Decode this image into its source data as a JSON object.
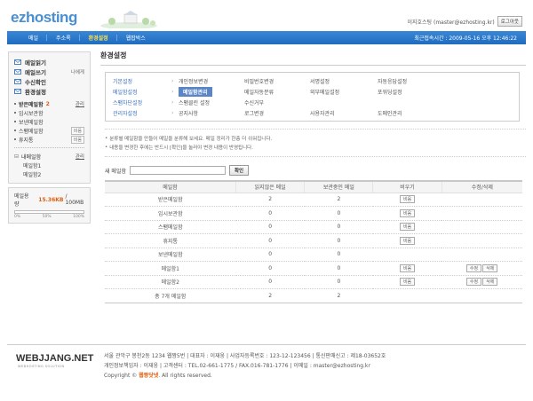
{
  "header": {
    "logo": "ezhosting",
    "user_text": "이지호스팅 (master@ezhosting.kr)",
    "logout_label": "로그아웃"
  },
  "topnav": {
    "items": [
      "메일",
      "주소록",
      "환경설정",
      "웹팝박스"
    ],
    "active_index": 2,
    "last_login": "최근접속시간 : 2009-05-16 오후 12:46:22"
  },
  "sidebar": {
    "main_items": [
      {
        "label": "메일읽기",
        "icon": "mail-read-icon"
      },
      {
        "label": "메일쓰기",
        "icon": "mail-write-icon",
        "extra": "나에게"
      },
      {
        "label": "수신확인",
        "icon": "receipt-check-icon"
      },
      {
        "label": "환경설정",
        "icon": "settings-icon"
      }
    ],
    "inbox_label": "받은메일함",
    "inbox_count": "2",
    "manage_label": "관리",
    "folders": [
      {
        "label": "임시보관함"
      },
      {
        "label": "보낸메일함"
      },
      {
        "label": "스팸메일함",
        "action": "비움"
      },
      {
        "label": "휴지통",
        "action": "비움"
      }
    ],
    "my_folders_label": "내메일함",
    "my_manage_label": "관리",
    "my_folders": [
      "메일함1",
      "메일함2"
    ],
    "quota": {
      "label": "메일용량",
      "used": "15.36KB",
      "total": "/ 100MB",
      "fraction": 0.0002,
      "scale": [
        "0%",
        "50%",
        "100%"
      ]
    }
  },
  "content": {
    "title": "환경설정",
    "settings_rows": [
      [
        "기본설정",
        "개인정보변경",
        "비밀번호변경",
        "서명설정",
        "자동응답설정"
      ],
      [
        "메일함설정",
        "메일함관리",
        "메일자동분류",
        "외부메일설정",
        "포워딩설정"
      ],
      [
        "스팸차단설정",
        "스팸클린 설정",
        "수신거부",
        "",
        ""
      ],
      [
        "관리자설정",
        "공지사항",
        "로그변경",
        "사용자관리",
        "도메인관리"
      ]
    ],
    "selected_setting": "메일함관리",
    "notes": [
      "분류별 메일함을 만들어 메일을 분류해 보세요. 메일 정리가 한층 더 쉬워집니다.",
      "내용을 변경한 후에는 반드시 [확인]을 눌러야 변경 내용이 반영됩니다."
    ],
    "new_folder_label": "새 메일함",
    "new_folder_value": "",
    "confirm_label": "확인",
    "table": {
      "headers": [
        "메일함",
        "읽지않은 메일",
        "보관중인 메일",
        "비우기",
        "수정/삭제"
      ],
      "rows": [
        {
          "name": "받은메일함",
          "unread": "2",
          "stored": "2",
          "empty": "비움",
          "edit": "",
          "delete": ""
        },
        {
          "name": "임시보관함",
          "unread": "0",
          "stored": "0",
          "empty": "비움",
          "edit": "",
          "delete": ""
        },
        {
          "name": "스팸메일함",
          "unread": "0",
          "stored": "0",
          "empty": "비움",
          "edit": "",
          "delete": ""
        },
        {
          "name": "휴지통",
          "unread": "0",
          "stored": "0",
          "empty": "비움",
          "edit": "",
          "delete": ""
        },
        {
          "name": "보낸메일함",
          "unread": "0",
          "stored": "0",
          "empty": "",
          "edit": "",
          "delete": ""
        },
        {
          "name": "메일함1",
          "unread": "0",
          "stored": "0",
          "empty": "비움",
          "edit": "수정",
          "delete": "삭제"
        },
        {
          "name": "메일함2",
          "unread": "0",
          "stored": "0",
          "empty": "비움",
          "edit": "수정",
          "delete": "삭제"
        }
      ],
      "total": {
        "name": "총 7개 메일함",
        "unread": "2",
        "stored": "2"
      }
    }
  },
  "footer": {
    "logo": "WEBJJANG.NET",
    "logo_sub": "WEBHOSTING SOLUTION",
    "line1": "서울 관악구 봉천2동 1234  웹짱5번 | 대표자 : 이재웅 | 사업자등록번호 : 123-12-123456 | 통신판매신고 : 제18-03652호",
    "line2": "개인정보책임자 : 이재웅 | 고객센터 : TEL.02-661-1775 / FAX.016-781-1776 | 이메일 : master@ezhosting.kr",
    "copyright_prefix": "Copyright ©",
    "copyright_brand": "웹짱닷넷",
    "copyright_suffix": ". All rights reserved."
  }
}
